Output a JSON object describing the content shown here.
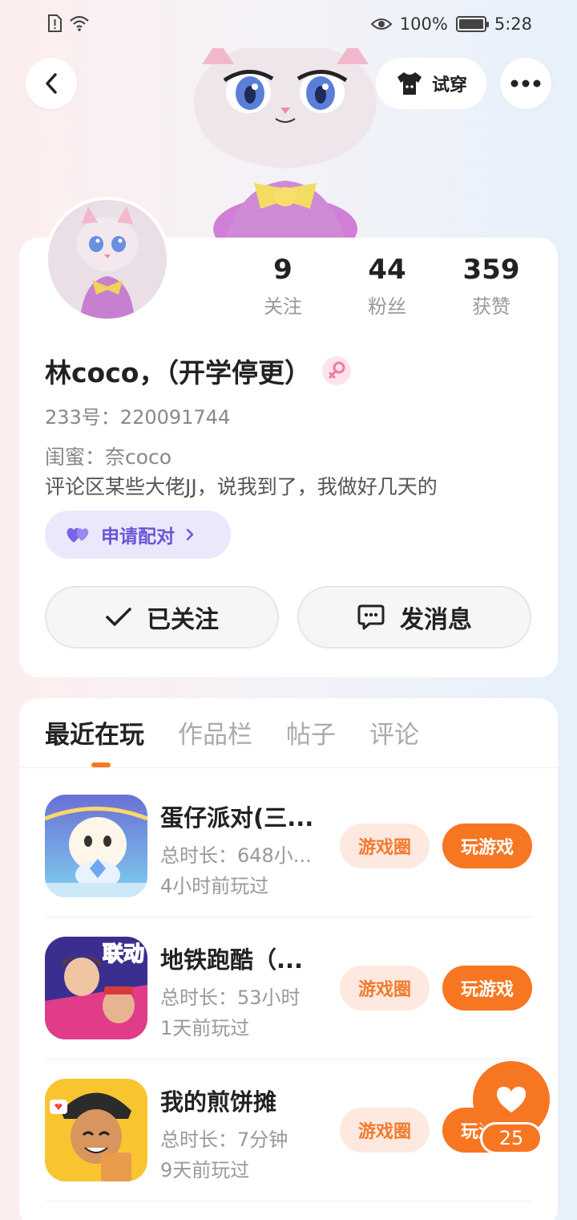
{
  "status_bar": {
    "battery": "100%",
    "time": "5:28",
    "icons": [
      "sim-alert-icon",
      "wifi-icon",
      "eye-icon",
      "battery-icon"
    ]
  },
  "header": {
    "back_icon": "chevron-left-icon",
    "tryon_label": "试穿",
    "tryon_icon": "tshirt-icon",
    "more_icon": "more-dots-icon"
  },
  "profile": {
    "stats": [
      {
        "value": "9",
        "label": "关注"
      },
      {
        "value": "44",
        "label": "粉丝"
      },
      {
        "value": "359",
        "label": "获赞"
      }
    ],
    "nickname": "林coco，（开学停更）",
    "gender_icon": "female-icon",
    "uid": "233号：220091744",
    "bio_line1": "闺蜜：奈coco",
    "bio_line2": "评论区某些大佬JJ，说我到了，我做好几天的",
    "pair_label": "申请配对",
    "follow_label": "已关注",
    "message_label": "发消息"
  },
  "tabs": [
    {
      "label": "最近在玩",
      "active": true
    },
    {
      "label": "作品栏",
      "active": false
    },
    {
      "label": "帖子",
      "active": false
    },
    {
      "label": "评论",
      "active": false
    }
  ],
  "games": [
    {
      "name": "蛋仔派对(三...",
      "time": "总时长：648小...",
      "last": "4小时前玩过",
      "circle": "游戏圈",
      "play": "玩游戏"
    },
    {
      "name": "地铁跑酷（...",
      "time": "总时长：53小时",
      "last": "1天前玩过",
      "circle": "游戏圈",
      "play": "玩游戏",
      "icon_badge": "联动"
    },
    {
      "name": "我的煎饼摊",
      "time": "总时长：7分钟",
      "last": "9天前玩过",
      "circle": "游戏圈",
      "play": "玩游戏"
    }
  ],
  "like": {
    "count": "25"
  },
  "colors": {
    "accent": "#f67622",
    "pair_purple": "#6a55d9",
    "pair_bg": "#ece8fb"
  }
}
